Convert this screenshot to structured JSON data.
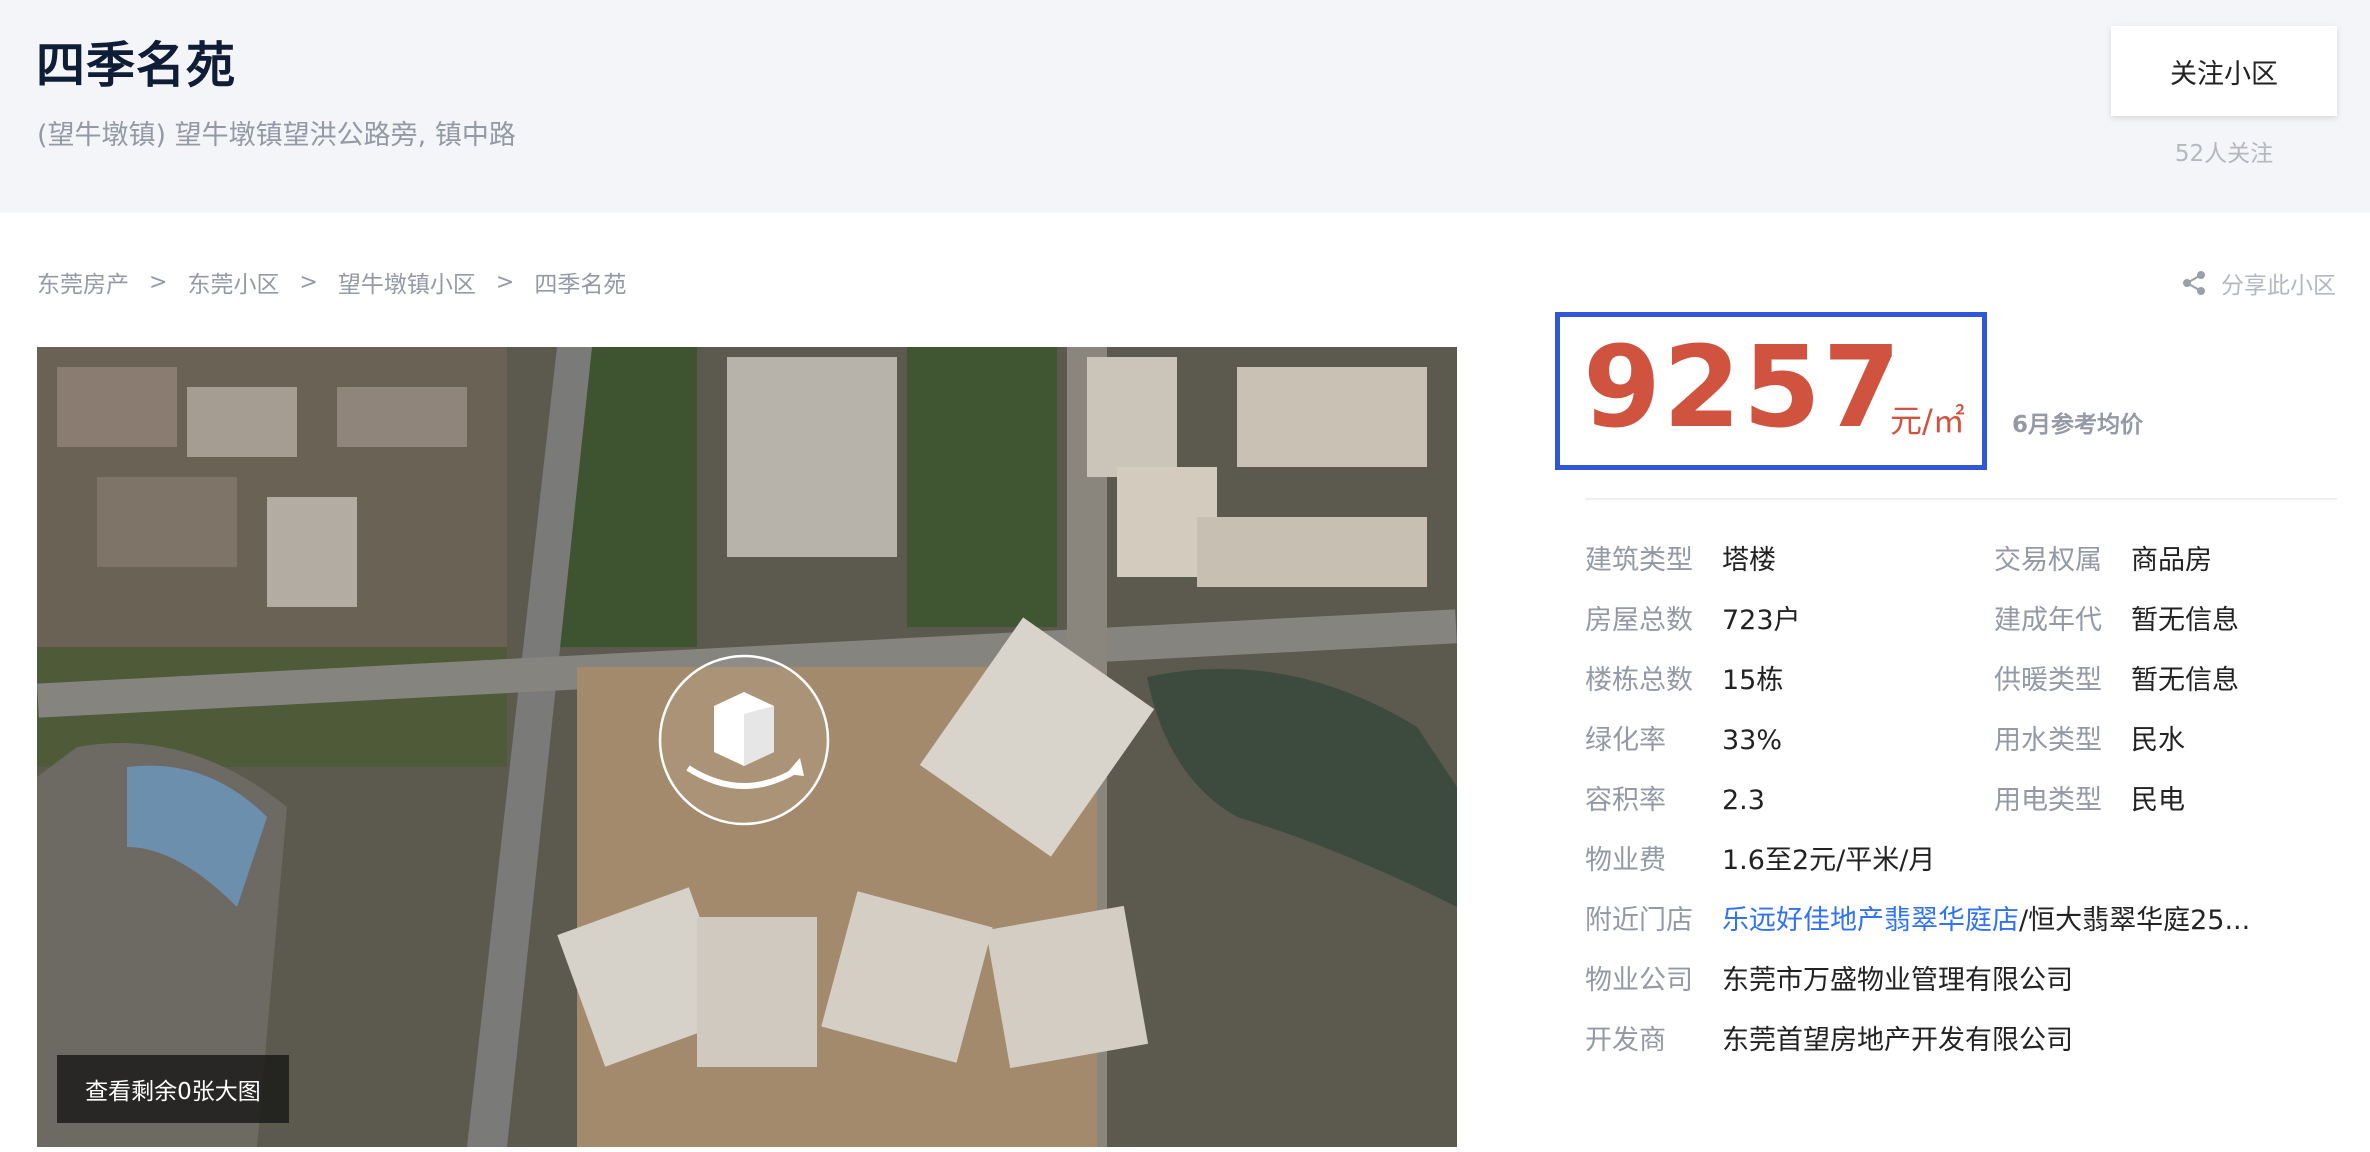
{
  "header": {
    "title": "四季名苑",
    "address": "(望牛墩镇) 望牛墩镇望洪公路旁, 镇中路",
    "follow_button": "关注小区",
    "follow_count": "52人关注"
  },
  "breadcrumb": [
    "东莞房产",
    "东莞小区",
    "望牛墩镇小区",
    "四季名苑"
  ],
  "breadcrumb_separator": ">",
  "share_label": "分享此小区",
  "photo": {
    "more_photos_label": "查看剩余0张大图"
  },
  "price": {
    "value": "9257",
    "unit": "元/㎡",
    "reference": "6月参考均价",
    "accent_color": "#d0533f",
    "highlight_color": "#2f56d6"
  },
  "info": {
    "rows": [
      {
        "label": "建筑类型",
        "value": "塔楼",
        "label2": "交易权属",
        "value2": "商品房"
      },
      {
        "label": "房屋总数",
        "value": "723户",
        "label2": "建成年代",
        "value2": "暂无信息"
      },
      {
        "label": "楼栋总数",
        "value": "15栋",
        "label2": "供暖类型",
        "value2": "暂无信息"
      },
      {
        "label": "绿化率",
        "value": "33%",
        "label2": "用水类型",
        "value2": "民水"
      },
      {
        "label": "容积率",
        "value": "2.3",
        "label2": "用电类型",
        "value2": "民电"
      }
    ],
    "property_fee_label": "物业费",
    "property_fee": "1.6至2元/平米/月",
    "nearby_store_label": "附近门店",
    "nearby_store_link": "乐远好佳地产翡翠华庭店",
    "nearby_store_rest": "/恒大翡翠华庭25...",
    "property_company_label": "物业公司",
    "property_company": "东莞市万盛物业管理有限公司",
    "developer_label": "开发商",
    "developer": "东莞首望房地产开发有限公司"
  }
}
